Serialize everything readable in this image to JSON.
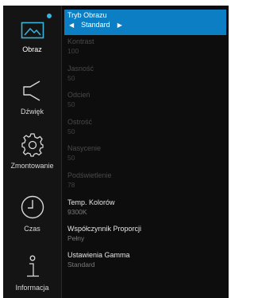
{
  "sidebar": {
    "items": [
      {
        "label": "Obraz",
        "icon": "picture-icon",
        "active": true
      },
      {
        "label": "Dźwięk",
        "icon": "speaker-icon"
      },
      {
        "label": "Zmontowanie",
        "icon": "gear-icon"
      },
      {
        "label": "Czas",
        "icon": "clock-icon"
      },
      {
        "label": "Informacja",
        "icon": "info-icon"
      }
    ],
    "accent_color": "#38b3dc"
  },
  "settings": {
    "tryb_obrazu": {
      "label": "Tryb Obrazu",
      "value": "Standard",
      "prev": "◀",
      "next": "▶"
    },
    "kontrast": {
      "label": "Kontrast",
      "value": "100"
    },
    "jasnosc": {
      "label": "Jasność",
      "value": "50"
    },
    "odcien": {
      "label": "Odcień",
      "value": "50"
    },
    "ostrosc": {
      "label": "Ostrość",
      "value": "50"
    },
    "nasycenie": {
      "label": "Nasycenie",
      "value": "50"
    },
    "podswietlenie": {
      "label": "Podświetlenie",
      "value": "78"
    },
    "temp_kolorow": {
      "label": "Temp. Kolorów",
      "value": "9300K"
    },
    "wspolczynnik": {
      "label": "Współczynnik Proporcji",
      "value": "Pełny"
    },
    "gamma": {
      "label": "Ustawienia Gamma",
      "value": "Standard"
    }
  },
  "colors": {
    "selection": "#0c7fc4",
    "background": "#0d0d0d"
  }
}
